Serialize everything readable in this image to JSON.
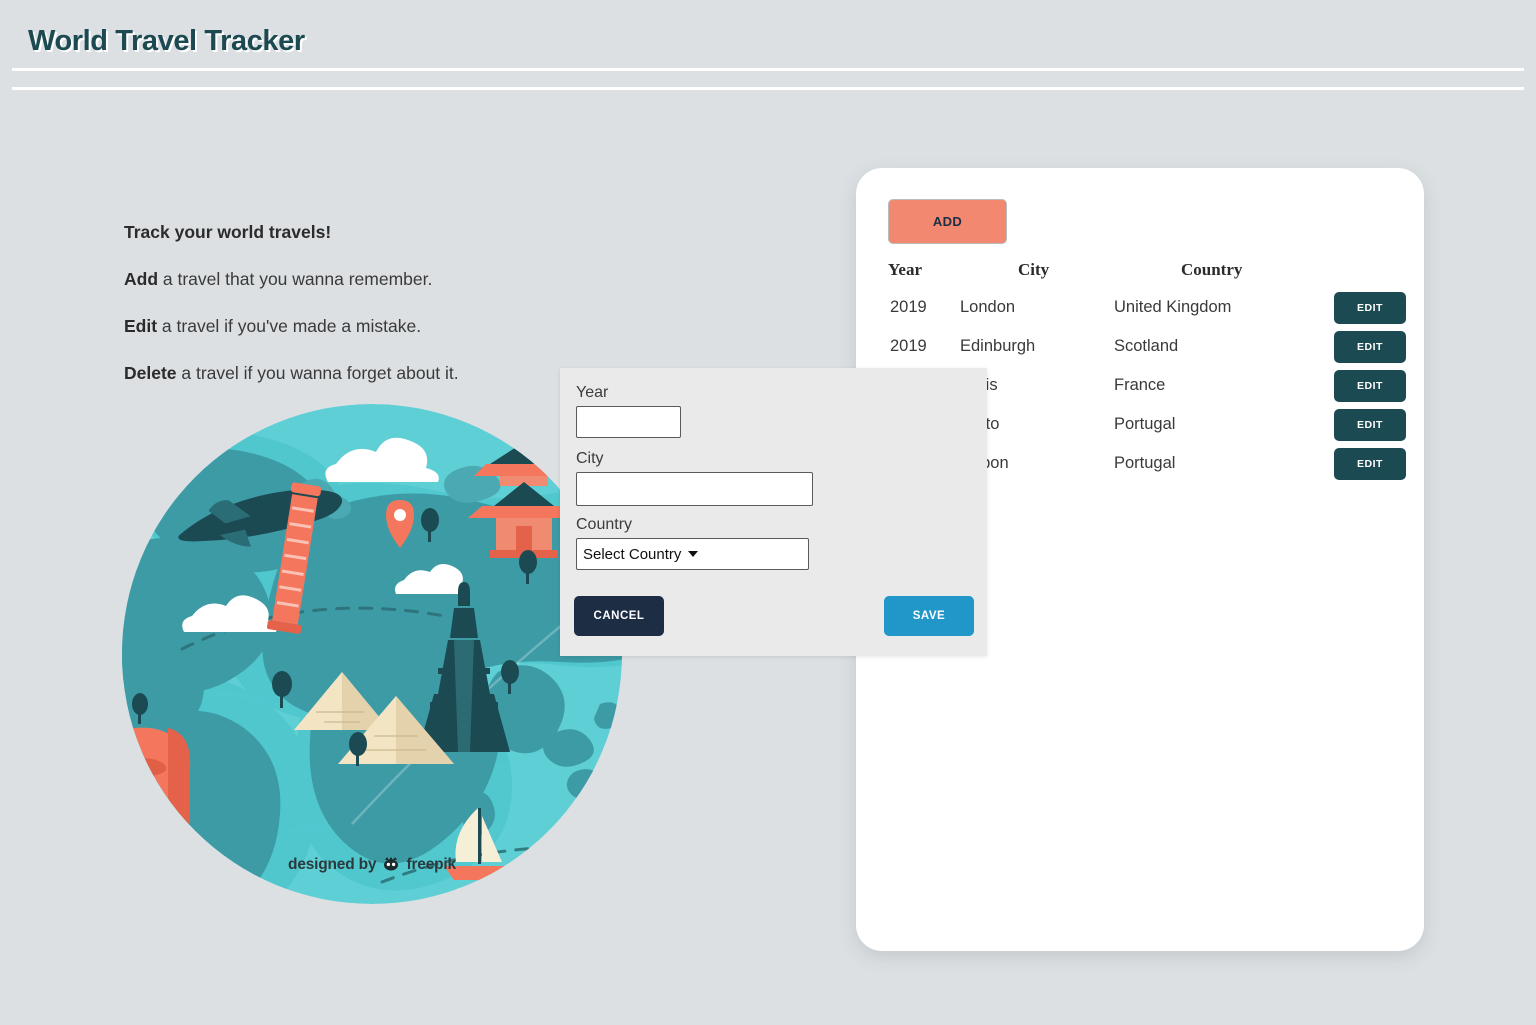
{
  "header": {
    "title": "World Travel Tracker"
  },
  "intro": {
    "heading": "Track your world travels!",
    "lines": [
      {
        "bold": "Add",
        "rest": " a travel that you wanna remember."
      },
      {
        "bold": "Edit",
        "rest": " a travel if you've made a mistake."
      },
      {
        "bold": "Delete",
        "rest": " a travel if you wanna forget about it."
      }
    ]
  },
  "illustration": {
    "name": "world-globe-illustration",
    "credit_prefix": "designed by",
    "credit_brand": "freepik",
    "colors": {
      "ocean": "#5ecfd4",
      "ocean_deep": "#47c3cc",
      "land": "#3d9ba6",
      "land_light": "#4aa9b2",
      "accent": "#f4765c",
      "dark": "#1b4a52",
      "sand": "#f3e5c3",
      "cloud": "#ffffff"
    }
  },
  "card": {
    "add_button": "ADD",
    "table": {
      "columns": [
        "Year",
        "City",
        "Country"
      ],
      "action_label": "EDIT",
      "rows": [
        {
          "year": "2019",
          "city": "London",
          "country": "United Kingdom"
        },
        {
          "year": "2019",
          "city": "Edinburgh",
          "country": "Scotland"
        },
        {
          "year": "",
          "city": "Paris",
          "country": "France"
        },
        {
          "year": "",
          "city": "Porto",
          "country": "Portugal"
        },
        {
          "year": "",
          "city": "Lisbon",
          "country": "Portugal"
        }
      ]
    }
  },
  "modal": {
    "fields": {
      "year": {
        "label": "Year",
        "value": "",
        "placeholder": ""
      },
      "city": {
        "label": "City",
        "value": "",
        "placeholder": ""
      },
      "country": {
        "label": "Country",
        "value": "Select Country"
      }
    },
    "cancel_label": "CANCEL",
    "save_label": "SAVE"
  },
  "colors": {
    "page_background": "#dce0e3",
    "title": "#1d4a52",
    "add_button": "#f2886f",
    "edit_button": "#1b4a52",
    "cancel_button": "#1d2d44",
    "save_button": "#2196c9",
    "modal_background": "#eaeaea",
    "card_background": "#ffffff"
  }
}
